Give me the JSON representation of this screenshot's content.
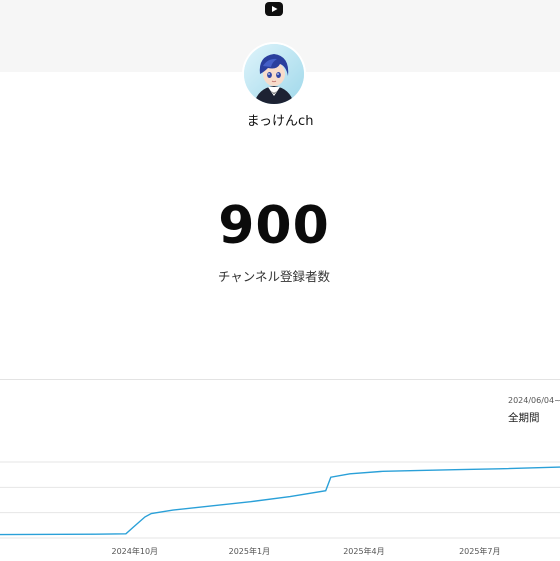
{
  "header": {
    "logo_icon": "youtube-play-icon"
  },
  "channel": {
    "name": "まっけんch",
    "avatar_icon": "anime-character-avatar"
  },
  "stats": {
    "subscriber_count": "900",
    "subscriber_label": "チャンネル登録者数"
  },
  "chart_panel": {
    "date_range": "2024/06/04~",
    "period": "全期間"
  },
  "chart_data": {
    "type": "line",
    "title": "",
    "xlabel": "",
    "ylabel": "",
    "x_tick_labels": [
      "2024年10月",
      "2025年1月",
      "2025年4月",
      "2025年7月"
    ],
    "x_tick_dates": [
      "2024-10-01",
      "2025-01-01",
      "2025-04-01",
      "2025-07-01"
    ],
    "x_range": [
      "2024-06-04",
      "2025-09-01"
    ],
    "grid": true,
    "line_color": "#2aa0d8",
    "series": [
      {
        "x": [
          "2024-06-04",
          "2024-09-01",
          "2024-09-25",
          "2024-10-01",
          "2024-10-10",
          "2024-10-15",
          "2024-11-01",
          "2024-12-01",
          "2025-01-01",
          "2025-02-01",
          "2025-03-01",
          "2025-03-05",
          "2025-03-20",
          "2025-04-15",
          "2025-05-15",
          "2025-06-15",
          "2025-07-15",
          "2025-09-01"
        ],
        "y": [
          40,
          45,
          50,
          130,
          250,
          290,
          330,
          380,
          430,
          490,
          560,
          720,
          760,
          790,
          800,
          810,
          820,
          840
        ]
      }
    ]
  }
}
